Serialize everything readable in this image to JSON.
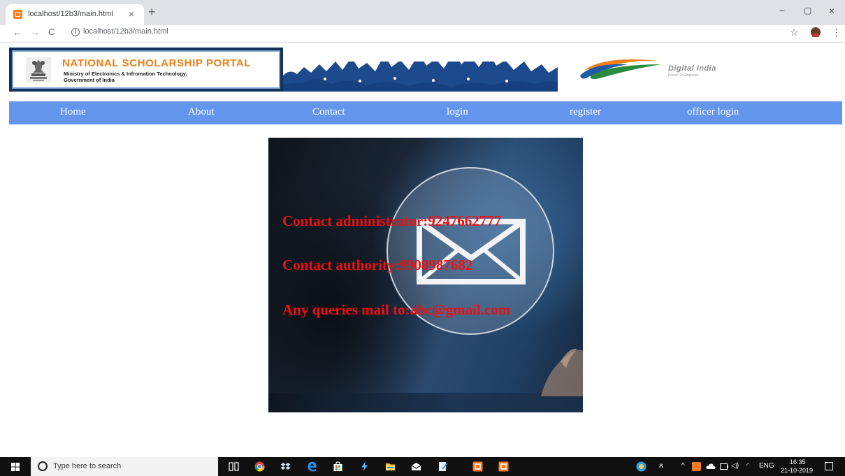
{
  "browser": {
    "tab_title": "localhost/12b3/main.html",
    "tab_close": "×",
    "new_tab": "+",
    "minimize": "−",
    "restore": "▢",
    "close": "×",
    "back": "←",
    "forward": "→",
    "reload": "C",
    "info": "i",
    "url": "localhost/12b3/main.html",
    "bookmark": "☆",
    "menu": "⋮"
  },
  "header": {
    "portal_title": "NATIONAL SCHOLARSHIP PORTAL",
    "ministry_line1": "Ministry of Electronics & Infromation Technology,",
    "ministry_line2": "Government of India",
    "digital_india_text": "Digital India",
    "digital_india_tagline": "Power To Empower"
  },
  "nav": {
    "items": [
      {
        "label": "Home"
      },
      {
        "label": "About"
      },
      {
        "label": "Contact"
      },
      {
        "label": "login"
      },
      {
        "label": "register"
      },
      {
        "label": "officer login"
      }
    ]
  },
  "contact": {
    "administrator": "Contact administrator:9247662777",
    "authority": "Contact authority:9908987682",
    "queries": "Any queries mail to:abc@gmail.com"
  },
  "taskbar": {
    "search_placeholder": "Type here to search",
    "language": "ENG",
    "time": "16:35",
    "date": "21-10-2019"
  },
  "colors": {
    "nav_bar": "#6495ed",
    "contact_text": "#ef0f0f",
    "portal_title": "#e8821c"
  }
}
